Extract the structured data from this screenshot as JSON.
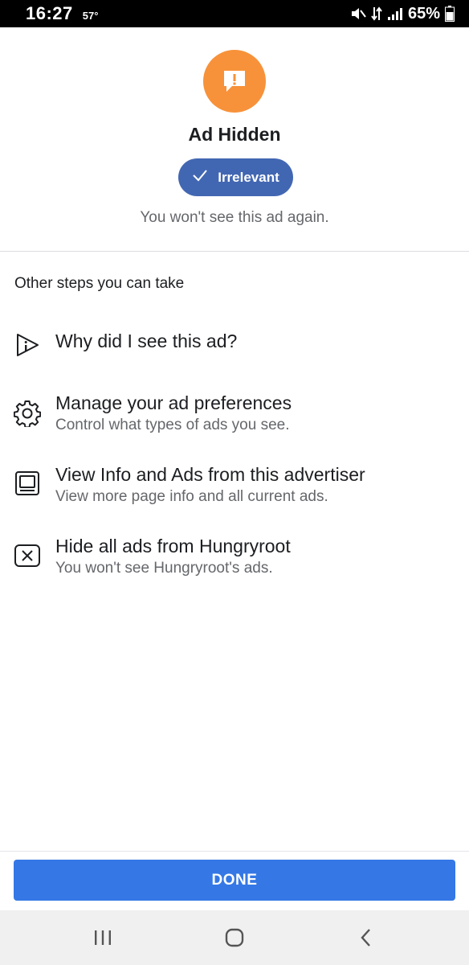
{
  "status_bar": {
    "time": "16:27",
    "temperature": "57°",
    "battery_percent": "65%",
    "icons": [
      "mute-icon",
      "data-transfer-icon",
      "signal-icon",
      "battery-icon"
    ]
  },
  "header": {
    "icon": "alert-icon",
    "icon_color": "#f7923a",
    "title": "Ad Hidden",
    "chip_label": "Irrelevant",
    "chip_icon": "check-icon",
    "chip_color": "#4267b2",
    "subtitle": "You won't see this ad again."
  },
  "steps": {
    "heading": "Other steps you can take",
    "items": [
      {
        "icon": "play-info-icon",
        "title": "Why did I see this ad?",
        "subtitle": ""
      },
      {
        "icon": "gear-icon",
        "title": "Manage your ad preferences",
        "subtitle": "Control what types of ads you see."
      },
      {
        "icon": "page-info-icon",
        "title": "View Info and Ads from this advertiser",
        "subtitle": "View more page info and all current ads."
      },
      {
        "icon": "close-box-icon",
        "title": "Hide all ads from Hungryroot",
        "subtitle": "You won't see Hungryroot's ads."
      }
    ]
  },
  "footer": {
    "done_label": "DONE",
    "button_color": "#3578e5"
  },
  "nav_bar": {
    "buttons": [
      "recent-apps-icon",
      "home-icon",
      "back-icon"
    ]
  }
}
